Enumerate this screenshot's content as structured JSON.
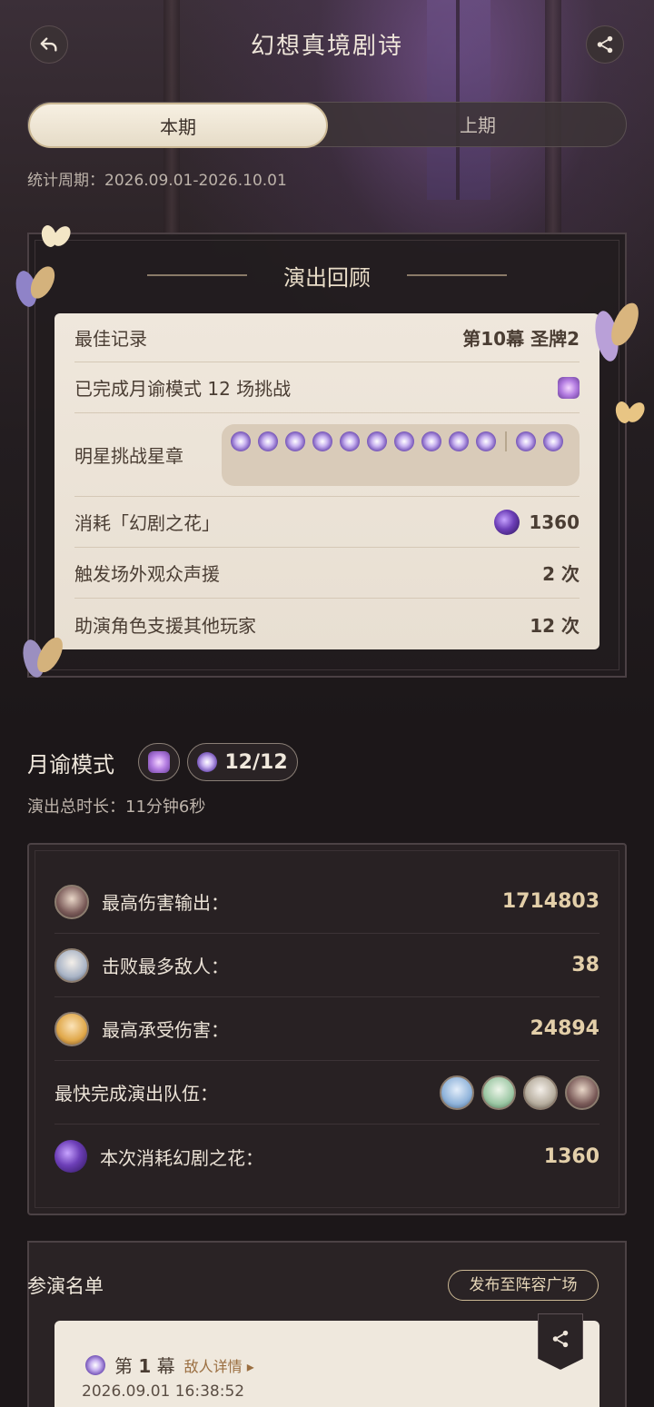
{
  "header": {
    "title": "幻想真境剧诗",
    "back_icon": "back-arrow-icon",
    "share_icon": "share-icon"
  },
  "tabs": [
    {
      "label": "本期",
      "active": true
    },
    {
      "label": "上期",
      "active": false
    }
  ],
  "period_text": "统计周期：2026.09.01-2026.10.01",
  "review": {
    "title": "演出回顾",
    "best_record_label": "最佳记录",
    "best_record_act": "第10幕",
    "best_record_medal": "圣牌2",
    "completed_label": "已完成月谕模式 12 场挑战",
    "star_badge_label": "明星挑战星章",
    "star_badge_count": 12,
    "flowers_label": "消耗「幻剧之花」",
    "flowers_value": "1360",
    "audience_label": "触发场外观众声援",
    "audience_value": "2 次",
    "support_label": "助演角色支援其他玩家",
    "support_value": "12 次"
  },
  "mode": {
    "title": "月谕模式",
    "progress": "12/12",
    "duration": "演出总时长：11分钟6秒"
  },
  "stats": {
    "max_damage_label": "最高伤害输出：",
    "max_damage_value": "1714803",
    "most_defeats_label": "击败最多敌人：",
    "most_defeats_value": "38",
    "max_taken_label": "最高承受伤害：",
    "max_taken_value": "24894",
    "fastest_team_label": "最快完成演出队伍：",
    "flowers_used_label": "本次消耗幻剧之花：",
    "flowers_used_value": "1360"
  },
  "roster": {
    "title": "参演名单",
    "publish_label": "发布至阵容广场",
    "act_prefix": "第",
    "act_number": "1",
    "act_suffix": "幕",
    "enemy_link": "敌人详情 ▸",
    "timestamp": "2026.09.01 16:38:52"
  },
  "colors": {
    "accent_gold": "#e3cfa9",
    "card_bg": "#efe7dc",
    "star_purple": "#6a48b0"
  }
}
